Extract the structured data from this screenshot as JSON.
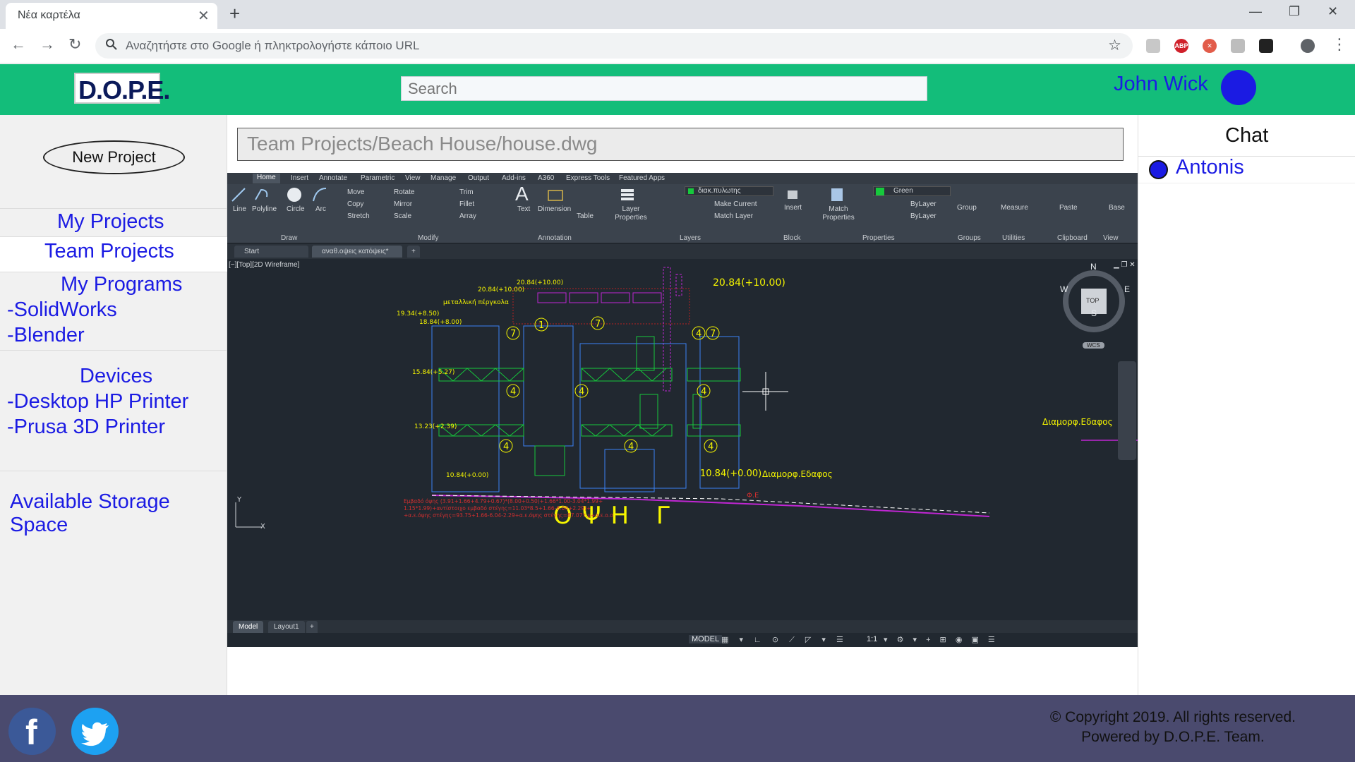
{
  "browser": {
    "tab_title": "Νέα καρτέλα",
    "omnibox_placeholder": "Αναζητήστε στο Google ή πληκτρολογήστε κάποιο URL"
  },
  "header": {
    "logo_text": "D.O.P.E.",
    "search_placeholder": "Search",
    "user_name": "John Wick"
  },
  "sidebar": {
    "new_project_label": "New Project",
    "my_projects": "My Projects",
    "team_projects": "Team Projects",
    "my_programs": "My Programs",
    "programs": [
      "-SolidWorks",
      "-Blender"
    ],
    "devices": "Devices",
    "device_items": [
      "-Desktop HP Printer",
      "-Prusa 3D Printer"
    ],
    "storage": "Available Storage Space"
  },
  "main": {
    "path": "Team Projects/Beach House/house.dwg"
  },
  "cad": {
    "ribbon_tabs": [
      "Home",
      "Insert",
      "Annotate",
      "Parametric",
      "View",
      "Manage",
      "Output",
      "Add-ins",
      "A360",
      "Express Tools",
      "Featured Apps"
    ],
    "tools": {
      "line": "Line",
      "polyline": "Polyline",
      "circle": "Circle",
      "arc": "Arc",
      "move": "Move",
      "rotate": "Rotate",
      "trim": "Trim",
      "copy": "Copy",
      "mirror": "Mirror",
      "fillet": "Fillet",
      "stretch": "Stretch",
      "scale": "Scale",
      "array": "Array",
      "text": "Text",
      "dimension": "Dimension",
      "table": "Table",
      "layer_properties": "Layer Properties",
      "layer_name": "διακ.πυλωτης",
      "make_current": "Make Current",
      "match_layer": "Match Layer",
      "insert": "Insert",
      "match_properties": "Match Properties",
      "color": "Green",
      "bylayer1": "ByLayer",
      "bylayer2": "ByLayer",
      "group": "Group",
      "measure": "Measure",
      "paste": "Paste",
      "base": "Base"
    },
    "groups": [
      "Draw",
      "Modify",
      "Annotation",
      "Layers",
      "Block",
      "Properties",
      "Groups",
      "Utilities",
      "Clipboard",
      "View"
    ],
    "doc_tabs": [
      "Start",
      "αναθ.οψεις κατόψεις*"
    ],
    "viewport_label": "[−][Top][2D Wireframe]",
    "layout_tabs": [
      "Model",
      "Layout1"
    ],
    "status_model": "MODEL",
    "scale": "1:1",
    "compass": {
      "n": "N",
      "s": "S",
      "e": "E",
      "w": "W",
      "top": "TOP",
      "wcs": "WCS"
    },
    "drawing": {
      "title": "ΟΨΗ  Γ",
      "levels": [
        "20.84(+10.00)",
        "20.84(+10.00)",
        "20.84(+10.00)",
        "19.34(+8.50)",
        "18.84(+8.00)",
        "15.84(+5.27)",
        "13.23(+2.39)",
        "10.84(+0.00)",
        "10.84(+0.00)"
      ],
      "note_pergola": "μεταλλική πέργκολα",
      "ground1": "Διαμορφ.Εδαφος",
      "ground2": "Διαμορφ.Εδαφος",
      "fe": "Φ.Ε",
      "area_lines": [
        "Εμβαδό όψης (3.91+1.66+4.79+0.67)*(8.00+0.50)+1.66*1.00-3.04*1.99+",
        "1.15*1.99)+αντίστοιχο εμβαδό στέγης=11.03*8.5+1.66-6.04+2.29)+",
        "+α.ε.όψης στέγης=93.75+1.66-6.04-2.29+α.ε.όψης στέγης=87.07τ.μ+α.ε.ο.σ"
      ]
    }
  },
  "chat": {
    "title": "Chat",
    "user": "Antonis"
  },
  "footer": {
    "copyright": "© Copyright 2019. All rights reserved.",
    "powered": "Powered by D.O.P.E. Team."
  },
  "colors": {
    "header": "#13bd7a",
    "accent": "#1b1be3",
    "footer": "#4a4a6e",
    "facebook": "#3b5998",
    "twitter": "#1da1f2"
  }
}
